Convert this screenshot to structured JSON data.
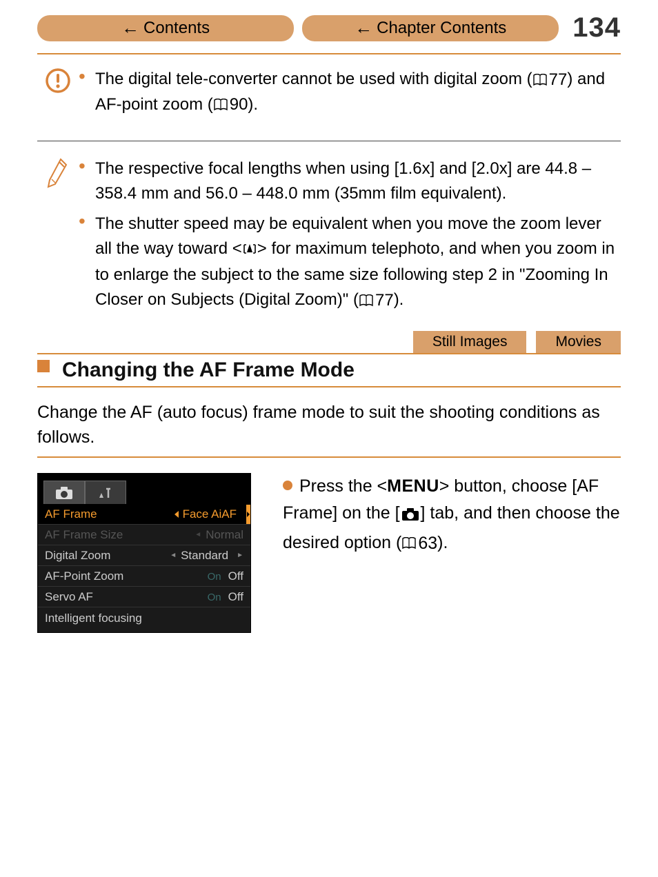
{
  "header": {
    "contents_label": "Contents",
    "chapter_contents_label": "Chapter Contents",
    "page_number": "134"
  },
  "warning": {
    "text_before_ref1": "The digital tele-converter cannot be used with digital zoom (",
    "ref1": "77",
    "text_between": ") and AF-point zoom (",
    "ref2": "90",
    "text_after": ")."
  },
  "notes": {
    "item1": "The respective focal lengths when using [1.6x] and [2.0x] are 44.8 – 358.4 mm and 56.0 – 448.0 mm (35mm film equivalent).",
    "item2_before": "The shutter speed may be equivalent when you move the zoom lever all the way toward <",
    "item2_mid": "> for maximum telephoto, and when you zoom in to enlarge the subject to the same size following step 2 in \"Zooming In Closer on Subjects (Digital Zoom)\" (",
    "item2_ref": "77",
    "item2_after": ")."
  },
  "tags": {
    "still": "Still Images",
    "movies": "Movies"
  },
  "section_title": "Changing the AF Frame Mode",
  "intro": "Change the AF (auto focus) frame mode to suit the shooting conditions as follows.",
  "menu": {
    "rows": {
      "r1": {
        "label": "AF Frame",
        "value": "Face AiAF"
      },
      "r2": {
        "label": "AF Frame Size",
        "value": "Normal"
      },
      "r3": {
        "label": "Digital Zoom",
        "value": "Standard"
      },
      "r4": {
        "label": "AF-Point Zoom",
        "on": "On",
        "value": "Off"
      },
      "r5": {
        "label": "Servo AF",
        "on": "On",
        "value": "Off"
      }
    },
    "footer": "Intelligent focusing"
  },
  "instruction": {
    "before_menu": "Press the <",
    "menu_word": "MENU",
    "after_menu_1": "> button, choose [AF Frame] on the [",
    "after_cam": "] tab, and then choose the desired option (",
    "ref": "63",
    "after_ref": ")."
  }
}
